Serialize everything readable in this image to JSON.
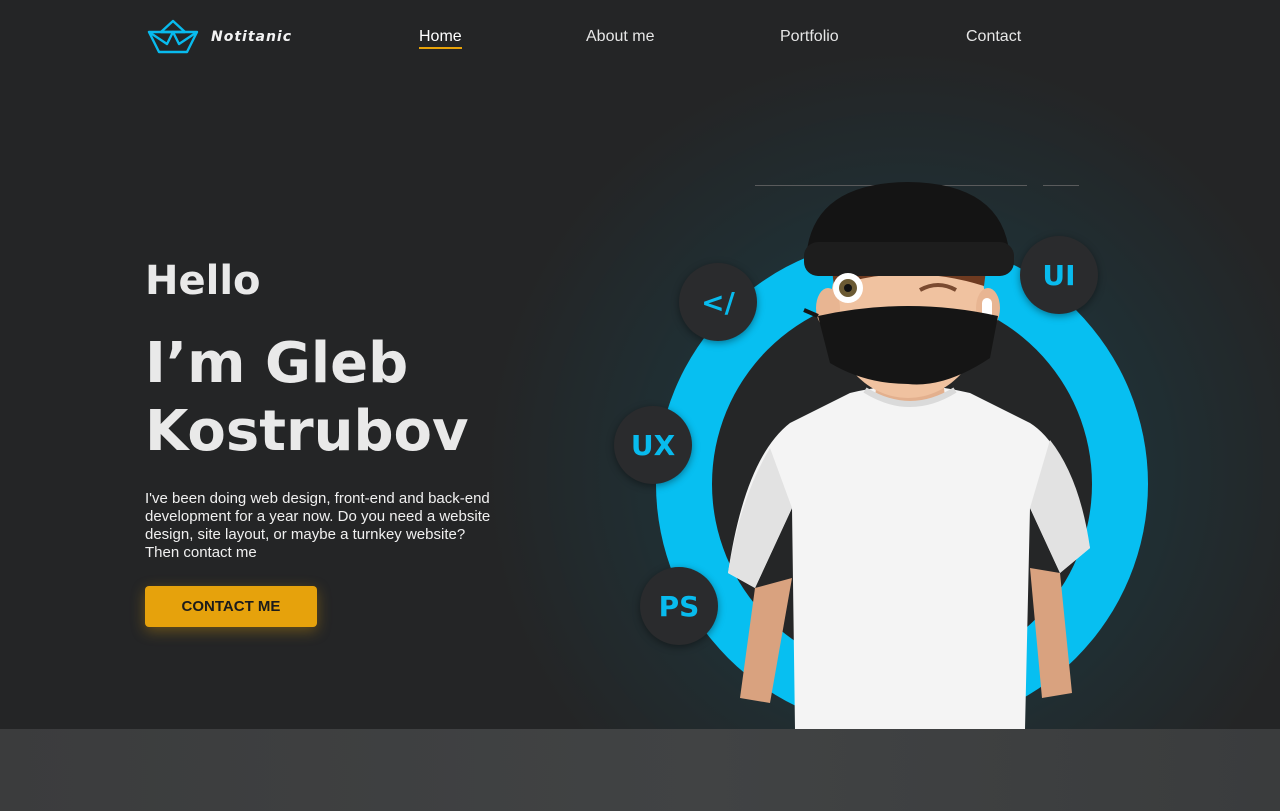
{
  "logo": {
    "text": "Notitanic",
    "icon": "paper-boat-icon",
    "color": "#08bbee"
  },
  "nav": {
    "items": [
      {
        "label": "Home",
        "active": true
      },
      {
        "label": "About me",
        "active": false
      },
      {
        "label": "Portfolio",
        "active": false
      },
      {
        "label": "Contact",
        "active": false
      }
    ]
  },
  "hero": {
    "greeting": "Hello",
    "name_line1": "I’m Gleb",
    "name_line2": "Kostrubov",
    "description": "I've been doing web design, front-end and back-end development for a year now. Do you need a website design, site layout, or maybe a turnkey website? Then contact me",
    "cta_label": "CONTACT ME"
  },
  "badges": {
    "code": "</",
    "ui": "UI",
    "ux": "UX",
    "ps": "PS"
  },
  "colors": {
    "accent": "#e6a20c",
    "brand": "#08bbee",
    "background": "#242526"
  }
}
